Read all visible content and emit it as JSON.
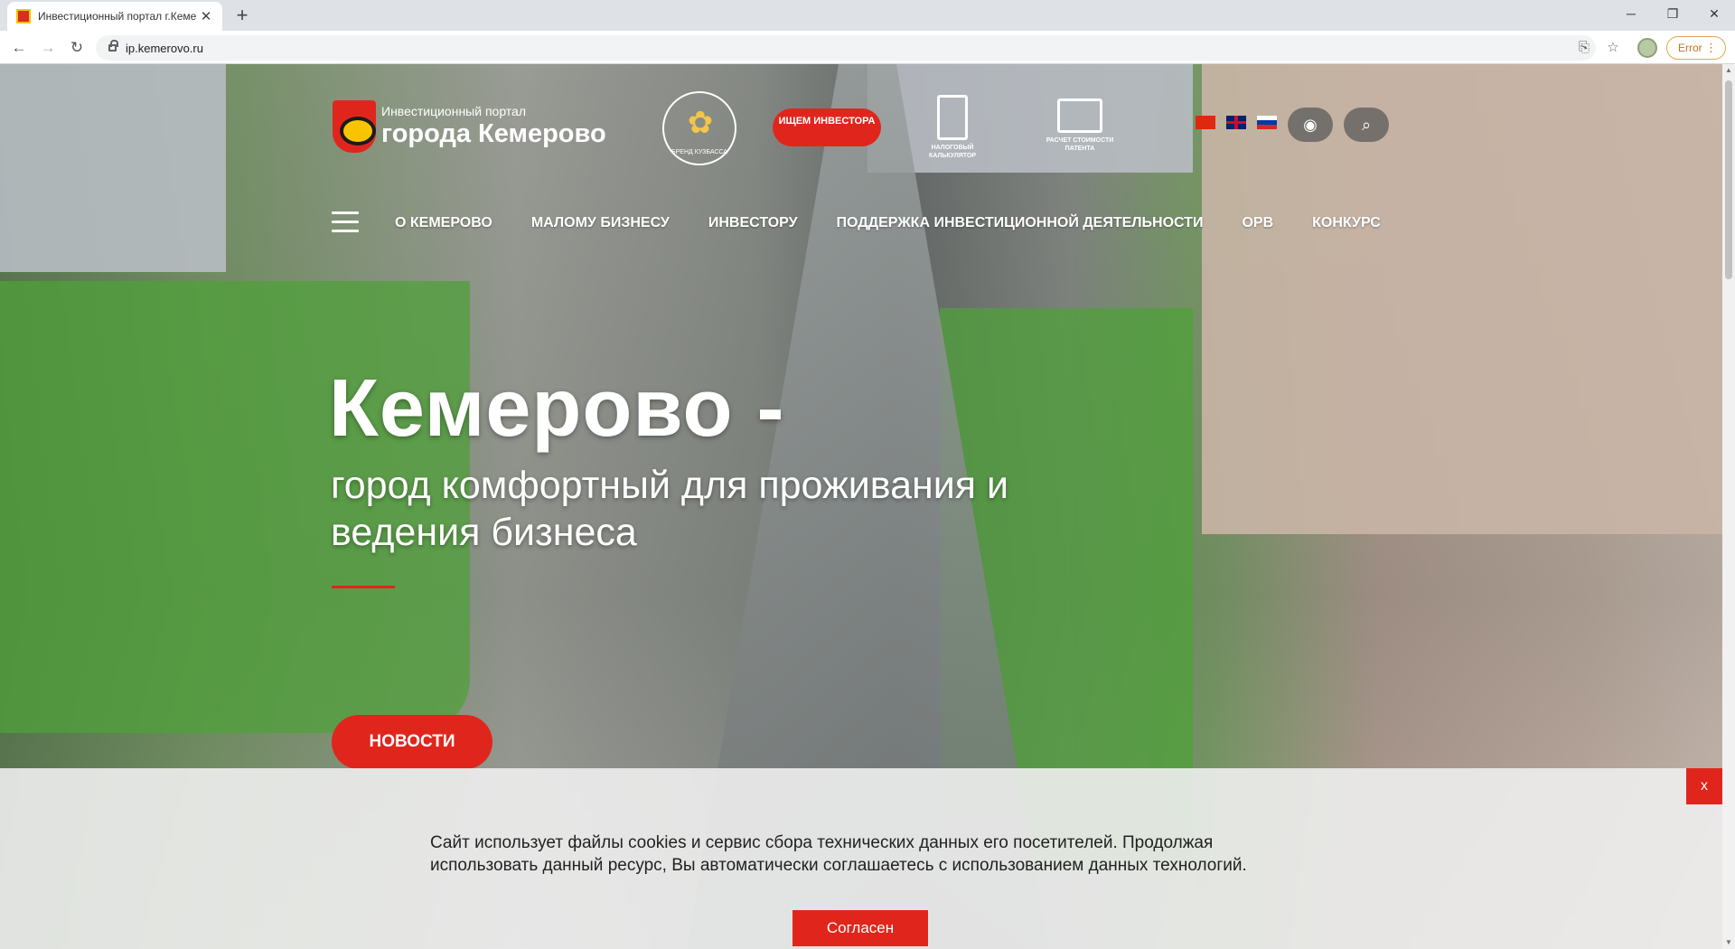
{
  "browser": {
    "tab_title": "Инвестиционный портал г.Кеме",
    "tab_close": "✕",
    "new_tab": "+",
    "url": "ip.kemerovo.ru",
    "error_label": "Error",
    "window_controls": [
      "─",
      "❐",
      "✕"
    ]
  },
  "header": {
    "logo_line1": "Инвестиционный портал",
    "logo_line2": "города Кемерово",
    "brand_caption": "БРЕНД КУЗБАССА",
    "investor_button": "ИЩЕМ ИНВЕСТОРА",
    "tax_calc_label": "НАЛОГОВЫЙ КАЛЬКУЛЯТОР",
    "patent_calc_label": "РАСЧЕТ СТОИМОСТИ ПАТЕНТА",
    "languages": [
      "zh",
      "en",
      "ru"
    ],
    "accessibility_icon": "eye-icon",
    "search_icon": "search-icon"
  },
  "nav": {
    "items": [
      "О КЕМЕРОВО",
      "МАЛОМУ БИЗНЕСУ",
      "ИНВЕСТОРУ",
      "ПОДДЕРЖКА ИНВЕСТИЦИОННОЙ ДЕЯТЕЛЬНОСТИ",
      "ОРВ",
      "КОНКУРС"
    ]
  },
  "hero": {
    "title": "Кемерово -",
    "subtitle": "город комфортный для проживания и ведения бизнеса",
    "news_button": "НОВОСТИ"
  },
  "cookie": {
    "close": "x",
    "text": "Сайт использует файлы cookies и сервис сбора технических данных его посетителей. Продолжая использовать данный ресурс, Вы автоматически соглашаетесь с использованием данных технологий.",
    "accept": "Согласен"
  },
  "colors": {
    "accent": "#e0261c",
    "brand_yellow": "#f8c400"
  }
}
